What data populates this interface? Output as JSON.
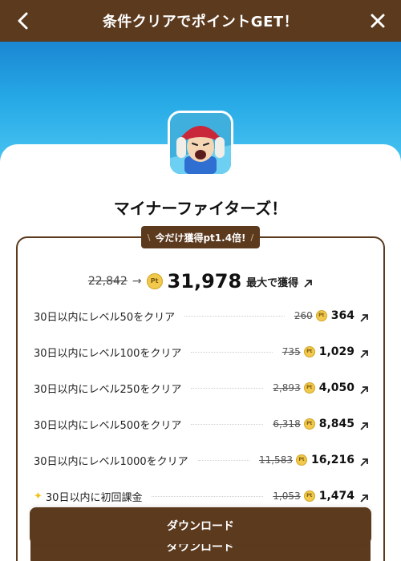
{
  "header": {
    "title": "条件クリアでポイントGET！",
    "back_icon": "chevron-left-icon",
    "close_icon": "close-icon"
  },
  "app": {
    "name": "マイナーファイターズ！",
    "icon": "app-character-icon"
  },
  "badge": {
    "left": "\\",
    "text": "今だけ獲得pt1.4倍!",
    "right": "/"
  },
  "total": {
    "old": "22,842",
    "arrow": "→",
    "coin": "Pt",
    "value": "31,978",
    "suffix": "最大で獲得"
  },
  "tasks": [
    {
      "label": "30日以内にレベル50をクリア",
      "old": "260",
      "new": "364"
    },
    {
      "label": "30日以内にレベル100をクリア",
      "old": "735",
      "new": "1,029"
    },
    {
      "label": "30日以内にレベル250をクリア",
      "old": "2,893",
      "new": "4,050"
    },
    {
      "label": "30日以内にレベル500をクリア",
      "old": "6,318",
      "new": "8,845"
    },
    {
      "label": "30日以内にレベル1000をクリア",
      "old": "11,583",
      "new": "16,216"
    },
    {
      "label": "30日以内に初回課金",
      "old": "1,053",
      "new": "1,474",
      "star": "✦"
    }
  ],
  "download": {
    "label": "ダウンロード",
    "label_behind": "ダウンロード"
  },
  "colors": {
    "brown": "#5b3a1e",
    "hero_blue": "#26a9e6",
    "coin_gold": "#f2c94c"
  }
}
